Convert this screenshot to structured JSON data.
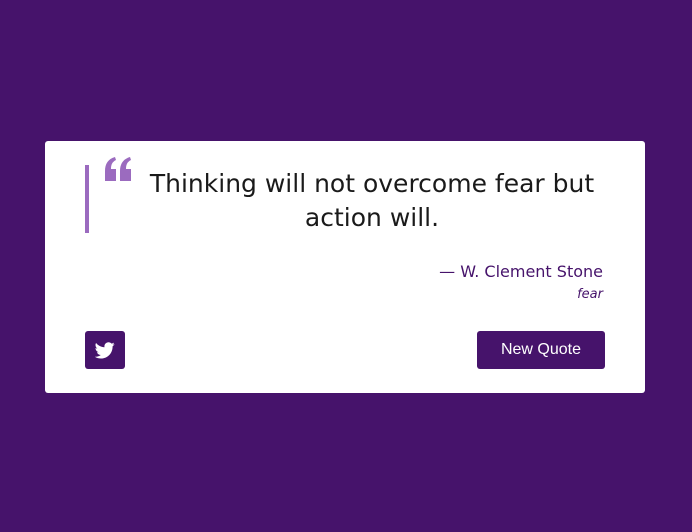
{
  "quote": {
    "text": "Thinking will not overcome fear but action will.",
    "author": "— W. Clement Stone",
    "tag": "fear"
  },
  "buttons": {
    "new_quote_label": "New Quote",
    "tweet_icon": "twitter-icon"
  },
  "colors": {
    "background": "#46136b",
    "accent": "#9b6bbf",
    "card": "#ffffff",
    "text": "#1a1a1a"
  }
}
